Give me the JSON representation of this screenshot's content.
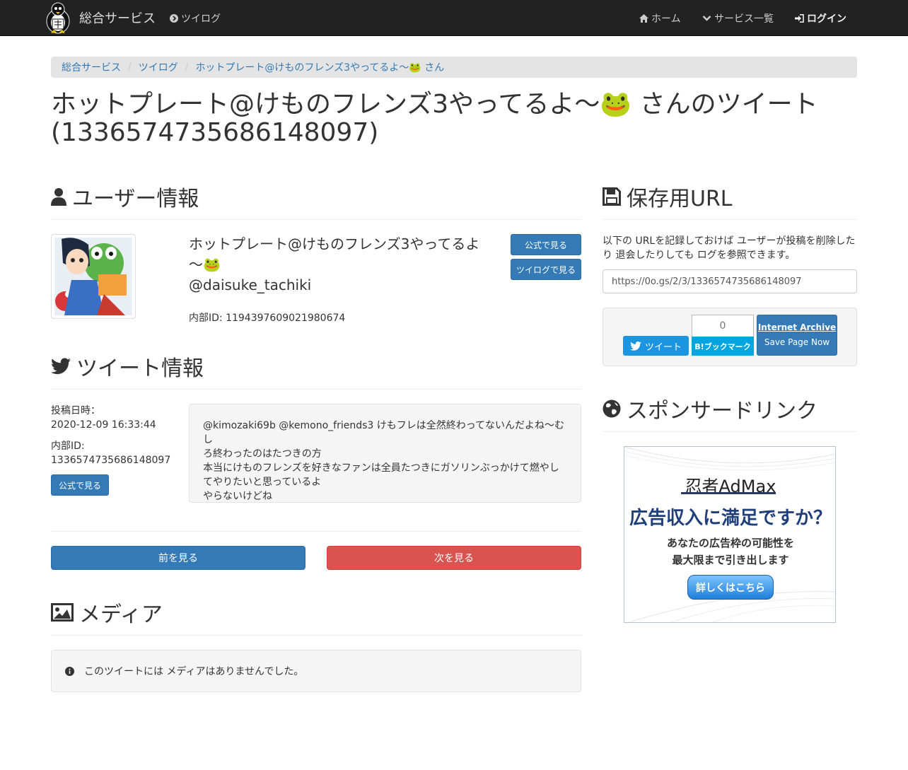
{
  "nav": {
    "brand": "総合サービス",
    "tweelog": "ツイログ",
    "home": "ホーム",
    "services": "サービス一覧",
    "login": "ログイン"
  },
  "breadcrumb": {
    "items": [
      "総合サービス",
      "ツイログ",
      "ホットプレート@けものフレンズ3やってるよ～🐸 さん"
    ]
  },
  "page": {
    "title": "ホットプレート@けものフレンズ3やってるよ～🐸 さんのツイート(1336574735686148097)"
  },
  "user_section": {
    "heading": "ユーザー情報",
    "name": "ホットプレート@けものフレンズ3やってるよ～🐸",
    "screen_name": "@daisuke_tachiki",
    "internal_id": "内部ID: 1194397609021980674",
    "btn_official": "公式で見る",
    "btn_tweelog": "ツイログで見る"
  },
  "tweet_section": {
    "heading": "ツイート情報",
    "posted_label": "投稿日時：",
    "posted_value": "2020-12-09 16:33:44",
    "id_label": "内部ID:",
    "id_value": "1336574735686148097",
    "btn_official": "公式で見る",
    "text_lines": [
      "@kimozaki69b @kemono_friends3 けもフレは全然終わってないんだよね～むし",
      "ろ終わったのはたつきの方",
      "本当にけものフレンズを好きなファンは全員たつきにガソリンぶっかけて燃やし",
      "てやりたいと思っているよ",
      "やらないけどね"
    ]
  },
  "pager": {
    "prev": "前を見る",
    "next": "次を見る"
  },
  "media_section": {
    "heading": "メディア",
    "empty": "このツイートには メディアはありませんでした。"
  },
  "save_section": {
    "heading": "保存用URL",
    "desc": "以下の URLを記録しておけば ユーザーが投稿を削除したり 退会したりしても ログを参照できます。",
    "url": "https://0o.gs/2/3/1336574735686148097",
    "tweet_btn": "ツイート",
    "hatena_count": "0",
    "hatena_btn": "B!ブックマーク",
    "ia_title": "Internet Archive",
    "ia_sub": "Save Page Now"
  },
  "sponsor_section": {
    "heading": "スポンサードリンク",
    "ad_logo": "忍者AdMax",
    "ad_head": "広告収入に満足ですか？",
    "ad_body_1": "あなたの広告枠の可能性を",
    "ad_body_2": "最大限まで引き出します",
    "ad_btn": "詳しくはこちら"
  },
  "colors": {
    "navbar": "#222222",
    "primary": "#337ab7",
    "danger": "#d9534f",
    "twitter": "#1b95e0",
    "hatena": "#00a4de"
  }
}
